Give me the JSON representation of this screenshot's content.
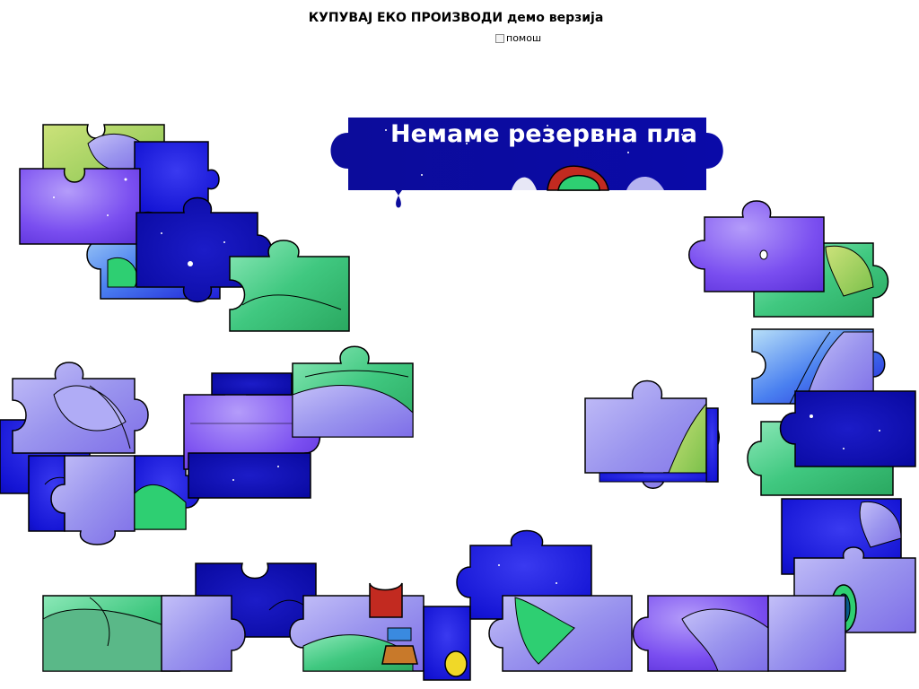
{
  "game": {
    "title": "КУПУВАЈ ЕКО ПРОИЗВОДИ демо верзија",
    "help_label": "помош",
    "banner_text": "Немаме резервна пла"
  },
  "palette": {
    "space_dark": "#1010d0",
    "space_mid": "#2a2ae8",
    "violet": "#8a5cf0",
    "lavender": "#a6a0f2",
    "green": "#2ecf72",
    "mint": "#6fd6a4",
    "lime": "#a6d24a",
    "sky": "#8fc0f0",
    "outline": "#000000",
    "banner_text": "#ffffff"
  },
  "icons": {
    "help": "checkbox-icon"
  }
}
